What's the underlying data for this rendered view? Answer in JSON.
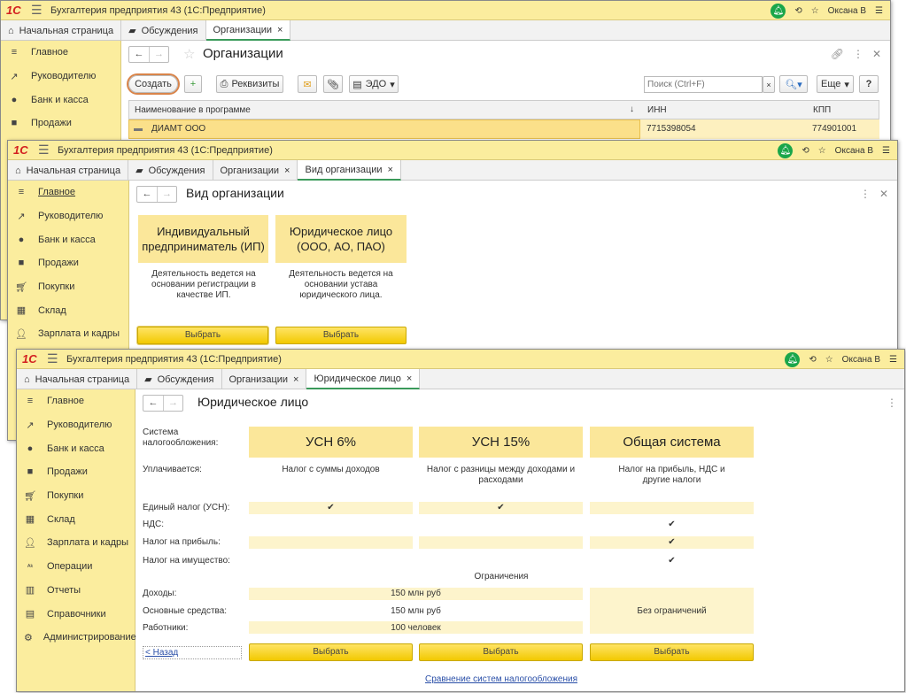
{
  "app": {
    "logo": "1С",
    "title": "Бухгалтерия предприятия 43  (1С:Предприятие)",
    "user": "Оксана В"
  },
  "window1": {
    "tabs": [
      "Начальная страница",
      "Обсуждения",
      "Организации"
    ],
    "sidebar": [
      "Главное",
      "Руководителю",
      "Банк и касса",
      "Продажи"
    ],
    "title": "Организации",
    "toolbar": {
      "create": "Создать",
      "details": "Реквизиты",
      "edo": "ЭДО",
      "search_placeholder": "Поиск (Ctrl+F)",
      "more": "Еще",
      "help": "?"
    },
    "table": {
      "columns": [
        "Наименование в программе",
        "ИНН",
        "КПП"
      ],
      "rows": [
        [
          "ДИАМТ ООО",
          "7715398054",
          "774901001"
        ]
      ]
    }
  },
  "window2": {
    "tabs": [
      "Начальная страница",
      "Обсуждения",
      "Организации",
      "Вид организации"
    ],
    "sidebar": [
      "Главное",
      "Руководителю",
      "Банк и касса",
      "Продажи",
      "Покупки",
      "Склад",
      "Зарплата и кадры"
    ],
    "title": "Вид организации",
    "cards": [
      {
        "title": "Индивидуальный предприниматель (ИП)",
        "desc": "Деятельность ведется на основании регистрации в качестве ИП.",
        "button": "Выбрать"
      },
      {
        "title": "Юридическое лицо (ООО, АО, ПАО)",
        "desc": "Деятельность ведется на основании устава юридического лица.",
        "button": "Выбрать"
      }
    ]
  },
  "window3": {
    "tabs": [
      "Начальная страница",
      "Обсуждения",
      "Организации",
      "Юридическое лицо"
    ],
    "sidebar": [
      "Главное",
      "Руководителю",
      "Банк и касса",
      "Продажи",
      "Покупки",
      "Склад",
      "Зарплата и кадры",
      "Операции",
      "Отчеты",
      "Справочники",
      "Администрирование"
    ],
    "title": "Юридическое лицо",
    "labels": {
      "system": "Система налогообложения:",
      "paid": "Уплачивается:",
      "usn": "Единый налог (УСН):",
      "nds": "НДС:",
      "profit": "Налог на прибыль:",
      "property": "Налог на имущество:",
      "limits": "Ограничения",
      "income": "Доходы:",
      "assets": "Основные средства:",
      "workers": "Работники:"
    },
    "systems": [
      {
        "name": "УСН 6%",
        "paid": "Налог с суммы доходов",
        "usn": true,
        "nds": false,
        "profit": false,
        "property": false
      },
      {
        "name": "УСН 15%",
        "paid": "Налог с разницы между доходами и расходами",
        "usn": true,
        "nds": false,
        "profit": false,
        "property": false
      },
      {
        "name": "Общая система",
        "paid": "Налог на прибыль, НДС и другие налоги",
        "usn": false,
        "nds": true,
        "profit": true,
        "property": true
      }
    ],
    "limits": {
      "income": "150 млн руб",
      "assets": "150 млн руб",
      "workers": "100 человек",
      "general": "Без ограничений"
    },
    "check": "✔",
    "select": "Выбрать",
    "back": "< Назад",
    "compare_link": "Сравнение систем налогообложения"
  }
}
